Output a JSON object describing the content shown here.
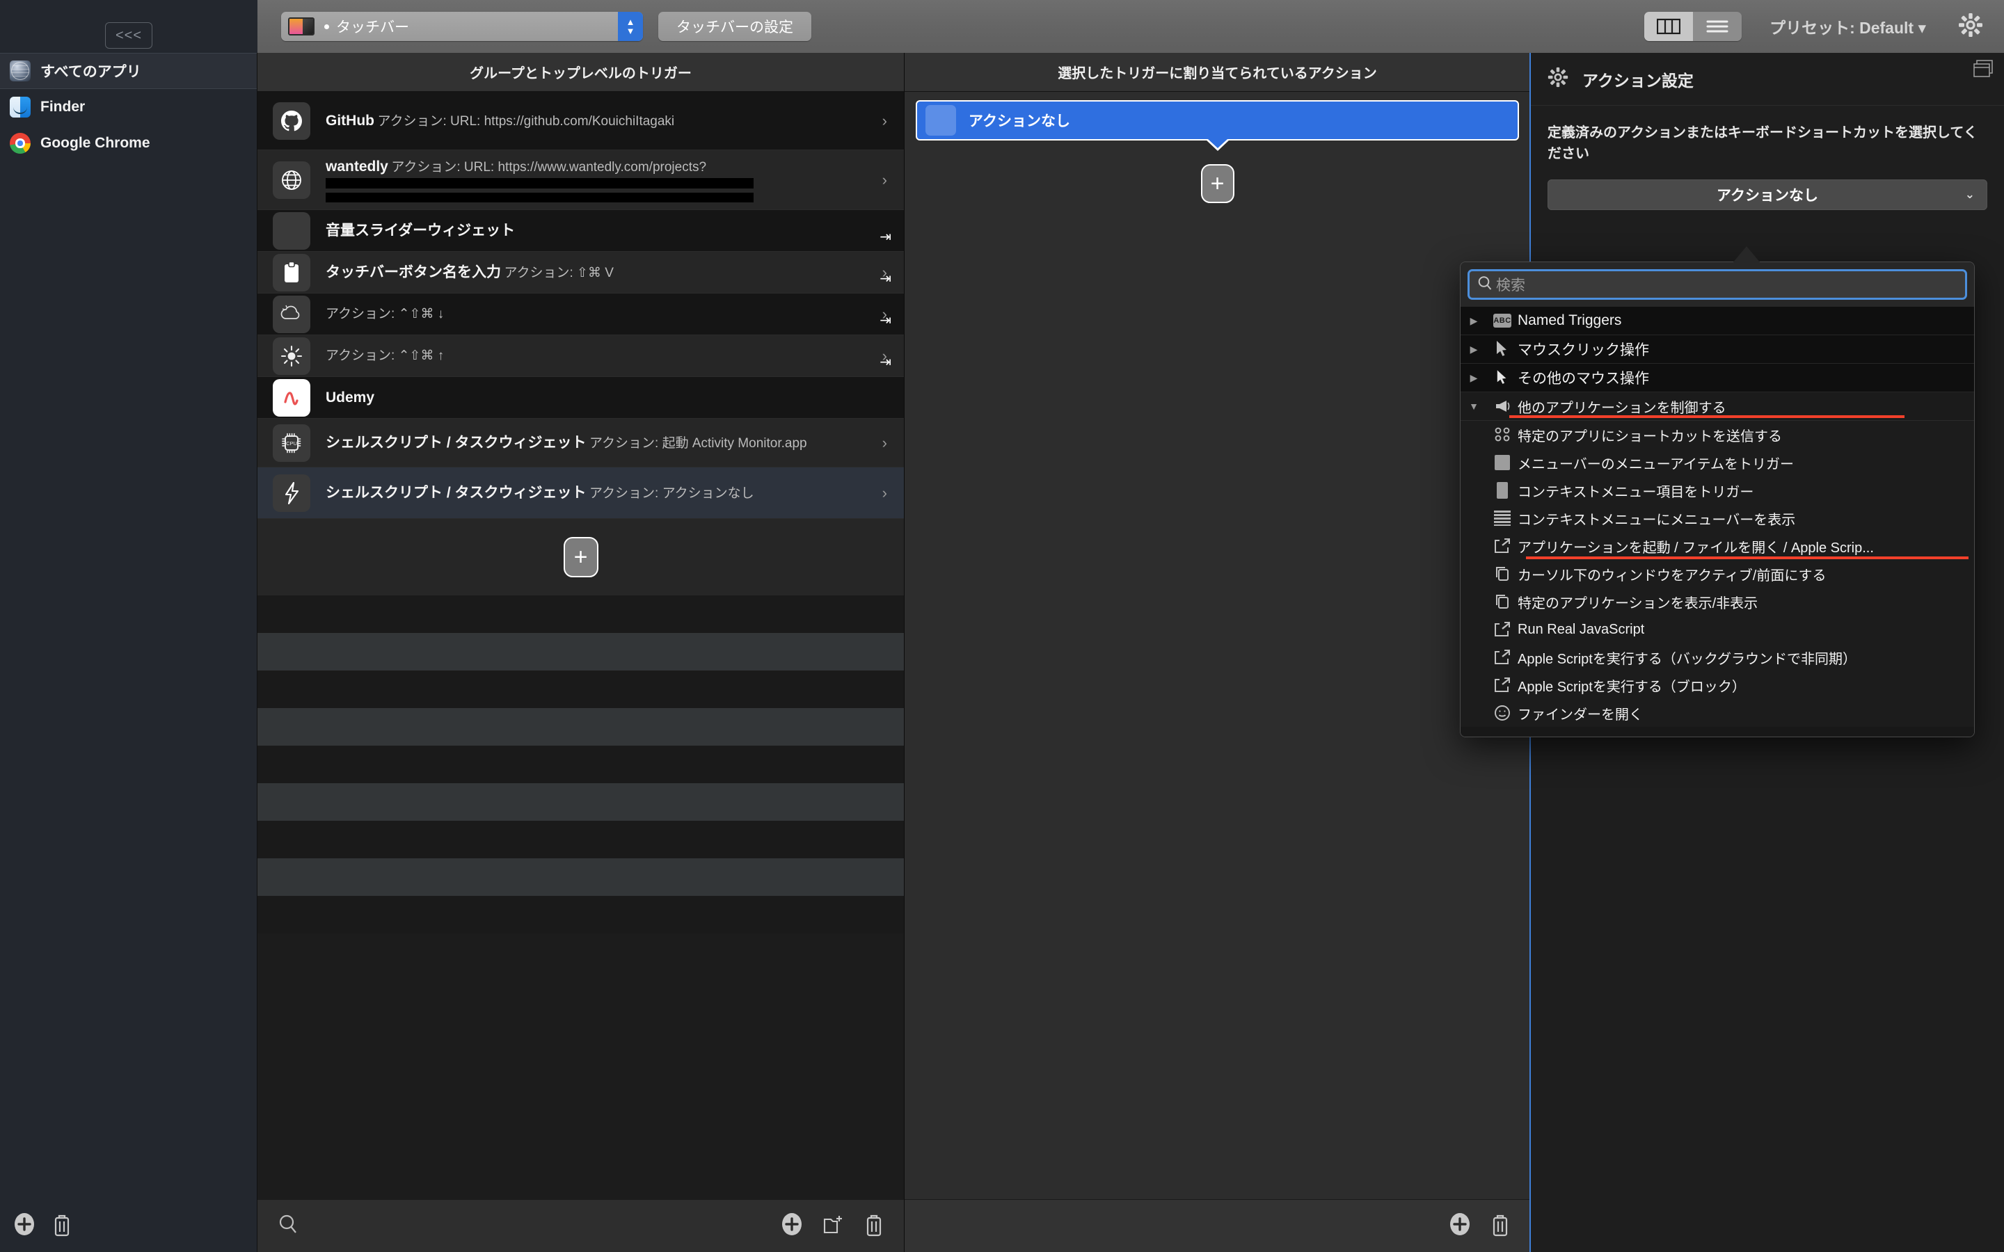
{
  "titlebar": {
    "collapse_label": "<<<",
    "preset_dropdown_value": "タッチバー",
    "touchbar_settings_button": "タッチバーの設定",
    "preset_label": "プリセット: Default ▾",
    "gear_icon": "gear-icon",
    "view_columns_icon": "columns-view-icon",
    "view_list_icon": "list-view-icon"
  },
  "sidebar": {
    "items": [
      {
        "label": "すべてのアプリ",
        "icon": "globe-icon",
        "selected": true
      },
      {
        "label": "Finder",
        "icon": "finder-icon",
        "selected": false
      },
      {
        "label": "Google Chrome",
        "icon": "chrome-icon",
        "selected": false
      }
    ],
    "add_button_icon": "plus-circle-icon",
    "delete_button_icon": "trash-icon"
  },
  "triggers": {
    "header": "グループとトップレベルのトリガー",
    "rows": [
      {
        "name": "GitHub",
        "sub": "アクション: URL: https://github.com/KouichiItagaki",
        "icon": "github-icon",
        "chevron": true,
        "arrow": false,
        "redacted": false,
        "selected": false
      },
      {
        "name": "wantedly",
        "sub": "アクション: URL: https://www.wantedly.com/projects?",
        "icon": "globe-line-icon",
        "chevron": true,
        "arrow": false,
        "redacted": true,
        "selected": false
      },
      {
        "name": "音量スライダーウィジェット",
        "sub": "",
        "icon": "blank-icon",
        "chevron": false,
        "arrow": true,
        "redacted": false,
        "selected": false
      },
      {
        "name": "タッチバーボタン名を入力",
        "sub": "アクション: ⇧⌘ V",
        "icon": "clipboard-icon",
        "chevron": true,
        "arrow": true,
        "redacted": false,
        "selected": false
      },
      {
        "name": "",
        "sub": "アクション: ⌃⇧⌘ ↓",
        "icon": "keyboard-backlight-down-icon",
        "chevron": true,
        "arrow": true,
        "redacted": false,
        "selected": false
      },
      {
        "name": "",
        "sub": "アクション: ⌃⇧⌘ ↑",
        "icon": "brightness-up-icon",
        "chevron": true,
        "arrow": true,
        "redacted": false,
        "selected": false
      },
      {
        "name": "Udemy",
        "sub": "",
        "icon": "udemy-icon",
        "chevron": false,
        "arrow": false,
        "redacted": false,
        "selected": false
      },
      {
        "name": "シェルスクリプト / タスクウィジェット",
        "sub": "アクション: 起動 Activity Monitor.app",
        "icon": "cpu-icon",
        "chevron": true,
        "arrow": false,
        "redacted": false,
        "selected": false
      },
      {
        "name": "シェルスクリプト / タスクウィジェット",
        "sub": "アクション: アクションなし",
        "icon": "bolt-icon",
        "chevron": true,
        "arrow": false,
        "redacted": false,
        "selected": true
      }
    ],
    "add_row_button": "+",
    "bottom_search_icon": "search-icon",
    "bottom_add_icon": "plus-circle-icon",
    "bottom_newgroup_icon": "new-folder-icon",
    "bottom_delete_icon": "trash-icon"
  },
  "actions": {
    "header": "選択したトリガーに割り当てられているアクション",
    "selected_action_label": "アクションなし",
    "add_action_button": "+",
    "bottom_add_icon": "plus-circle-icon",
    "bottom_delete_icon": "trash-icon"
  },
  "action_settings": {
    "title": "アクション設定",
    "window_icon": "window-icon",
    "gear_icon": "gear-icon",
    "description": "定義済みのアクションまたはキーボードショートカットを選択してください",
    "dropdown_value": "アクションなし",
    "chevron_icon": "chevron-down-icon"
  },
  "action_popup": {
    "search_placeholder": "検索",
    "search_icon": "search-icon",
    "top_items": [
      {
        "label": "Named Triggers",
        "icon": "abc-icon",
        "expanded": false
      },
      {
        "label": "マウスクリック操作",
        "icon": "cursor-filled-icon",
        "expanded": false
      },
      {
        "label": "その他のマウス操作",
        "icon": "cursor-outline-icon",
        "expanded": false
      },
      {
        "label": "他のアプリケーションを制御する",
        "icon": "megaphone-icon",
        "expanded": true,
        "underlined": true
      }
    ],
    "children": [
      {
        "label": "特定のアプリにショートカットを送信する",
        "icon": "keyboard-keys-icon",
        "underlined": false
      },
      {
        "label": "メニューバーのメニューアイテムをトリガー",
        "icon": "gray-square-icon",
        "underlined": false
      },
      {
        "label": "コンテキストメニュー項目をトリガー",
        "icon": "gray-square-icon",
        "underlined": false
      },
      {
        "label": "コンテキストメニューにメニューバーを表示",
        "icon": "lines-icon",
        "underlined": false
      },
      {
        "label": "アプリケーションを起動 / ファイルを開く / Apple Scrip...",
        "icon": "share-arrow-icon",
        "underlined": true
      },
      {
        "label": "カーソル下のウィンドウをアクティブ/前面にする",
        "icon": "copy-icon",
        "underlined": false
      },
      {
        "label": "特定のアプリケーションを表示/非表示",
        "icon": "copy-icon",
        "underlined": false
      },
      {
        "label": "Run Real JavaScript",
        "icon": "share-arrow-icon",
        "underlined": false
      },
      {
        "label": "Apple Scriptを実行する（バックグラウンドで非同期）",
        "icon": "share-arrow-icon",
        "underlined": false
      },
      {
        "label": "Apple Scriptを実行する（ブロック）",
        "icon": "share-arrow-icon",
        "underlined": false
      },
      {
        "label": "ファインダーを開く",
        "icon": "smiley-icon",
        "underlined": false
      }
    ]
  },
  "colors": {
    "accent_blue": "#2f6fe0",
    "highlight_red": "#f2402a",
    "focus_ring": "#4c8fdc"
  }
}
